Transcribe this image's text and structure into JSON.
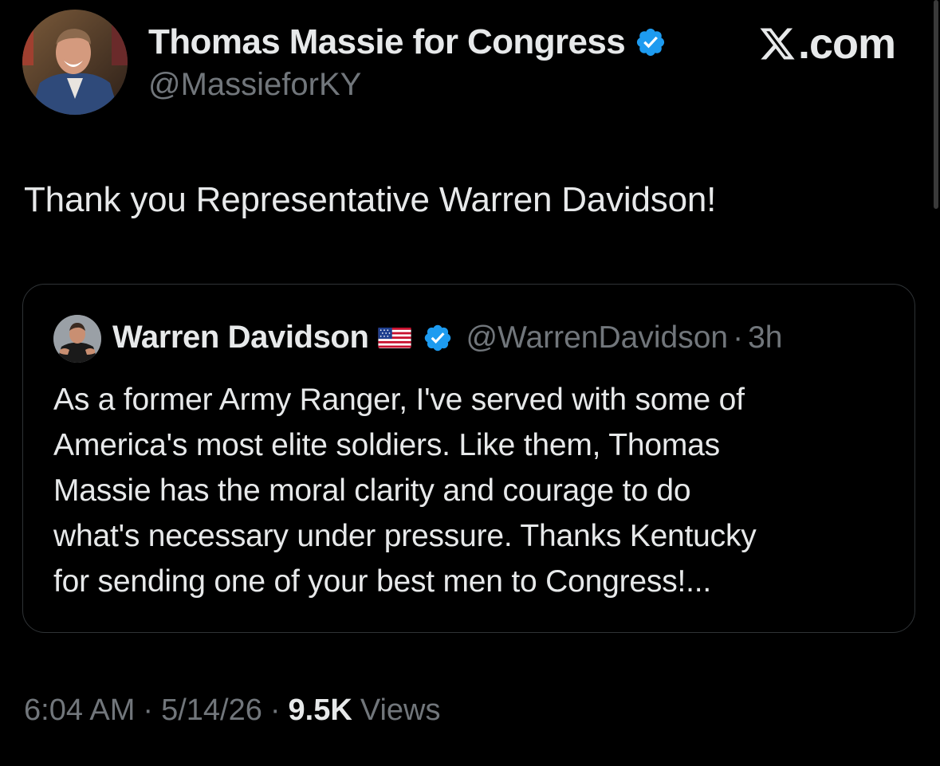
{
  "header": {
    "author_name": "Thomas Massie for Congress",
    "author_handle": "@MassieforKY",
    "brand_text": ".com",
    "brand_icon": "x-logo-icon"
  },
  "tweet": {
    "text": "Thank you Representative Warren Davidson!"
  },
  "quote": {
    "author_name": "Warren Davidson",
    "flag_icon": "us-flag-icon",
    "author_handle": "@WarrenDavidson",
    "separator": "·",
    "time": "3h",
    "lines": [
      "As a former Army Ranger, I've served with some of",
      "America's most elite soldiers. Like them, Thomas",
      "Massie has the moral clarity and courage to do",
      "what's necessary under pressure. Thanks Kentucky",
      "for sending one of your best men to Congress!..."
    ]
  },
  "meta": {
    "time": "6:04 AM",
    "separator": "·",
    "date": "5/14/26",
    "views_count": "9.5K",
    "views_label": "Views"
  },
  "colors": {
    "background": "#000000",
    "primary_text": "#e7e9ea",
    "secondary_text": "#71767b",
    "verified_blue": "#1d9bf0",
    "card_border": "#2f3336"
  }
}
